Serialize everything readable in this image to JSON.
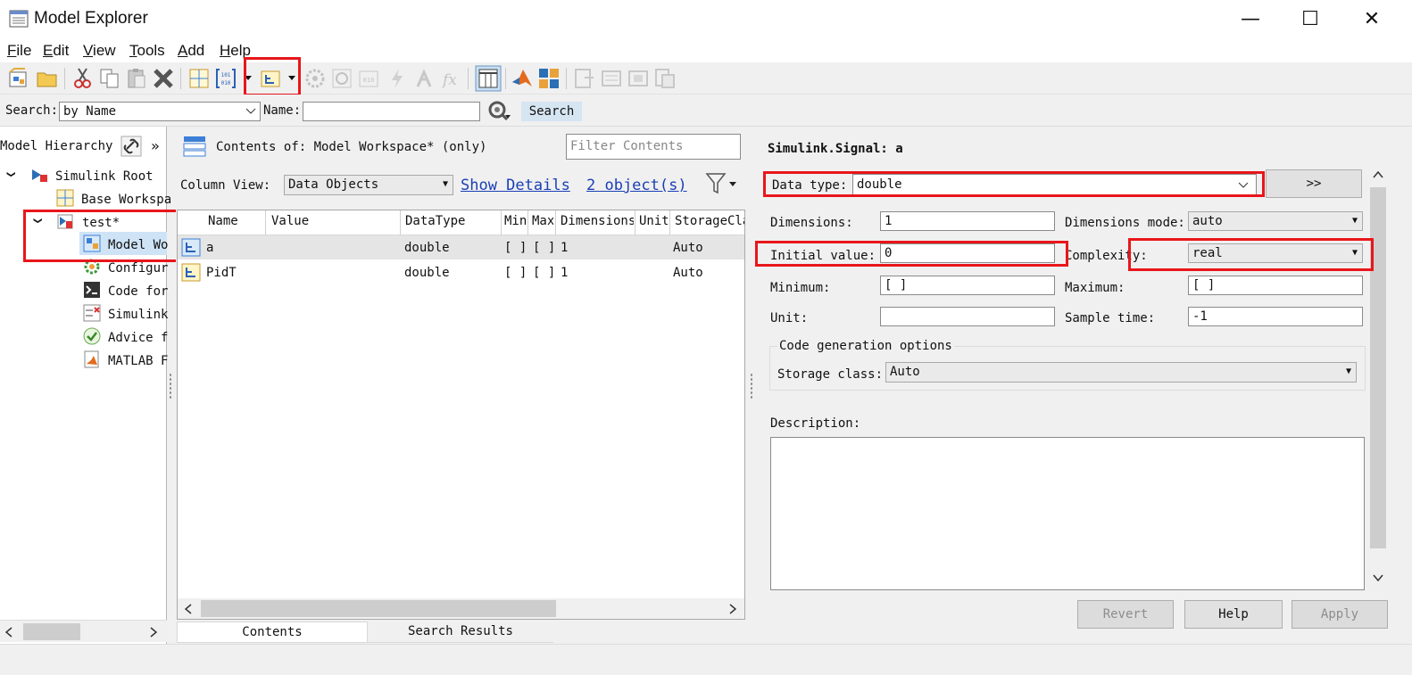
{
  "window": {
    "title": "Model Explorer",
    "controls": {
      "minimize": "—",
      "maximize": "☐",
      "close": "✕"
    }
  },
  "menu": [
    {
      "label": "File",
      "mnemonic": "F",
      "rest": "ile"
    },
    {
      "label": "Edit",
      "mnemonic": "E",
      "rest": "dit"
    },
    {
      "label": "View",
      "mnemonic": "V",
      "rest": "iew"
    },
    {
      "label": "Tools",
      "mnemonic": "T",
      "rest": "ools"
    },
    {
      "label": "Add",
      "mnemonic": "A",
      "rest": "dd"
    },
    {
      "label": "Help",
      "mnemonic": "H",
      "rest": "elp"
    }
  ],
  "toolbar": {
    "icons": [
      "new-model-icon",
      "open-icon",
      "cut-icon",
      "copy-icon",
      "paste-icon",
      "delete-icon",
      "grid-icon",
      "binary-data-icon",
      "add-signal-icon",
      "config-icon",
      "config2-icon",
      "data-store-icon",
      "lightning-icon",
      "function-icon",
      "fx-icon",
      "column-view-icon",
      "matlab-icon",
      "component-icon",
      "doc1-icon",
      "doc2-icon",
      "doc3-icon",
      "doc4-icon"
    ]
  },
  "search": {
    "label": "Search:",
    "by": "by Name",
    "name_label": "Name:",
    "name_value": "",
    "button": "Search"
  },
  "hierarchy": {
    "header": "Model Hierarchy",
    "more": "»",
    "items": [
      {
        "label": "Simulink Root",
        "expand": "❯"
      },
      {
        "label": "Base Workspa"
      },
      {
        "label": "test*",
        "expand": "❯"
      },
      {
        "label": "Model Wo"
      },
      {
        "label": "Configur"
      },
      {
        "label": "Code for"
      },
      {
        "label": "Simulink"
      },
      {
        "label": "Advice f"
      },
      {
        "label": "MATLAB F"
      }
    ]
  },
  "contents": {
    "header": "Contents of: Model Workspace* (only)",
    "filter_placeholder": "Filter Contents",
    "column_view_label": "Column View:",
    "column_view_value": "Data Objects",
    "show_details": "Show Details",
    "object_count": "2 object(s)",
    "columns": [
      "Name",
      "Value",
      "DataType",
      "Min",
      "Max",
      "Dimensions",
      "Unit",
      "StorageClass"
    ],
    "rows": [
      {
        "name": "a",
        "value": "",
        "datatype": "double",
        "min": "[ ]",
        "max": "[ ]",
        "dimensions": "1",
        "unit": "",
        "storage": "Auto"
      },
      {
        "name": "PidT",
        "value": "",
        "datatype": "double",
        "min": "[ ]",
        "max": "[ ]",
        "dimensions": "1",
        "unit": "",
        "storage": "Auto"
      }
    ],
    "tabs": [
      "Contents",
      "Search Results"
    ]
  },
  "details": {
    "title": "Simulink.Signal: a",
    "data_type_label": "Data type:",
    "data_type_value": "double",
    "expand_button": ">>",
    "dimensions_label": "Dimensions:",
    "dimensions_value": "1",
    "dimensions_mode_label": "Dimensions mode:",
    "dimensions_mode_value": "auto",
    "initial_value_label": "Initial value:",
    "initial_value_value": "0",
    "complexity_label": "Complexity:",
    "complexity_value": "real",
    "minimum_label": "Minimum:",
    "minimum_value": "[ ]",
    "maximum_label": "Maximum:",
    "maximum_value": "[ ]",
    "unit_label": "Unit:",
    "unit_value": "",
    "sample_time_label": "Sample time:",
    "sample_time_value": "-1",
    "codegen_group": "Code generation options",
    "storage_class_label": "Storage class:",
    "storage_class_value": "Auto",
    "description_label": "Description:",
    "description_value": "",
    "buttons": {
      "revert": "Revert",
      "help": "Help",
      "apply": "Apply"
    }
  },
  "colors": {
    "highlight": "#e8161b",
    "link": "#1a3fb5",
    "row_selected": "#e5e5e5"
  }
}
